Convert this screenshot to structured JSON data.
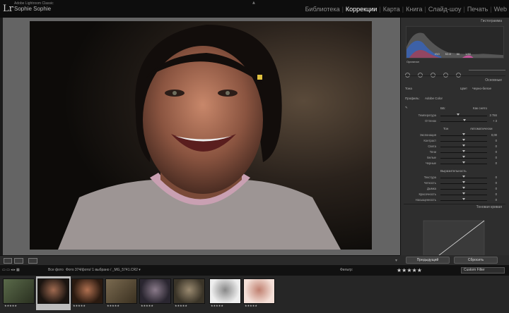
{
  "app": {
    "logo": "Lr",
    "catalog_line": "Adobe Lightroom Classic",
    "user_name": "Sophie Sophie"
  },
  "modules": [
    {
      "label": "Библиотека",
      "active": false
    },
    {
      "label": "Коррекции",
      "active": true
    },
    {
      "label": "Карта",
      "active": false
    },
    {
      "label": "Книга",
      "active": false
    },
    {
      "label": "Слайд-шоу",
      "active": false
    },
    {
      "label": "Печать",
      "active": false
    },
    {
      "label": "Web",
      "active": false
    }
  ],
  "right_panel": {
    "histogram_title": "Гистограмма",
    "histogram_values": [
      "ISO",
      "f/2.8",
      "50",
      "1/80"
    ],
    "original_label": "Оригинал",
    "basic_title": "Основные",
    "treatment_label": "Тона",
    "treatment_options": [
      "Цвет",
      "Черно-белое"
    ],
    "profile_label": "Профиль:",
    "profile_value": "Adobe Color",
    "wb_label": "ББ:",
    "wb_value": "Как снято",
    "tone_label": "Тон",
    "tone_auto": "Автоматически",
    "presence_label": "Выразительность",
    "tone_curve_title": "Тоновая кривая",
    "sliders_wb": [
      {
        "label": "Температура",
        "value": "3 784",
        "pos": 0.38
      },
      {
        "label": "Оттенок",
        "value": "+ 3",
        "pos": 0.52
      }
    ],
    "sliders_tone": [
      {
        "label": "Экспонация",
        "value": "0,00",
        "pos": 0.5
      },
      {
        "label": "Контраст",
        "value": "0",
        "pos": 0.5
      },
      {
        "label": "Света",
        "value": "0",
        "pos": 0.5
      },
      {
        "label": "Тени",
        "value": "0",
        "pos": 0.5
      },
      {
        "label": "Белые",
        "value": "0",
        "pos": 0.5
      },
      {
        "label": "Черные",
        "value": "0",
        "pos": 0.5
      }
    ],
    "sliders_presence": [
      {
        "label": "Текстура",
        "value": "0",
        "pos": 0.5
      },
      {
        "label": "Четкость",
        "value": "0",
        "pos": 0.5
      },
      {
        "label": "Дымка",
        "value": "0",
        "pos": 0.5
      },
      {
        "label": "Красочность",
        "value": "0",
        "pos": 0.5
      },
      {
        "label": "Насыщенность",
        "value": "0",
        "pos": 0.5
      }
    ],
    "prev_button": "Предыдущий",
    "reset_button": "Сбросить"
  },
  "filmstrip_bar": {
    "source": "Все фото",
    "count": "Фото 374/фото/ 1 выбрано / _MG_5741.CR2 ▾",
    "filter_label": "Фильтр:",
    "filter_value": "Custom Filter"
  },
  "colors": {
    "accent_active": "#ffffff",
    "panel_bg": "#2e2e2e",
    "photo_bg": "#646464"
  }
}
